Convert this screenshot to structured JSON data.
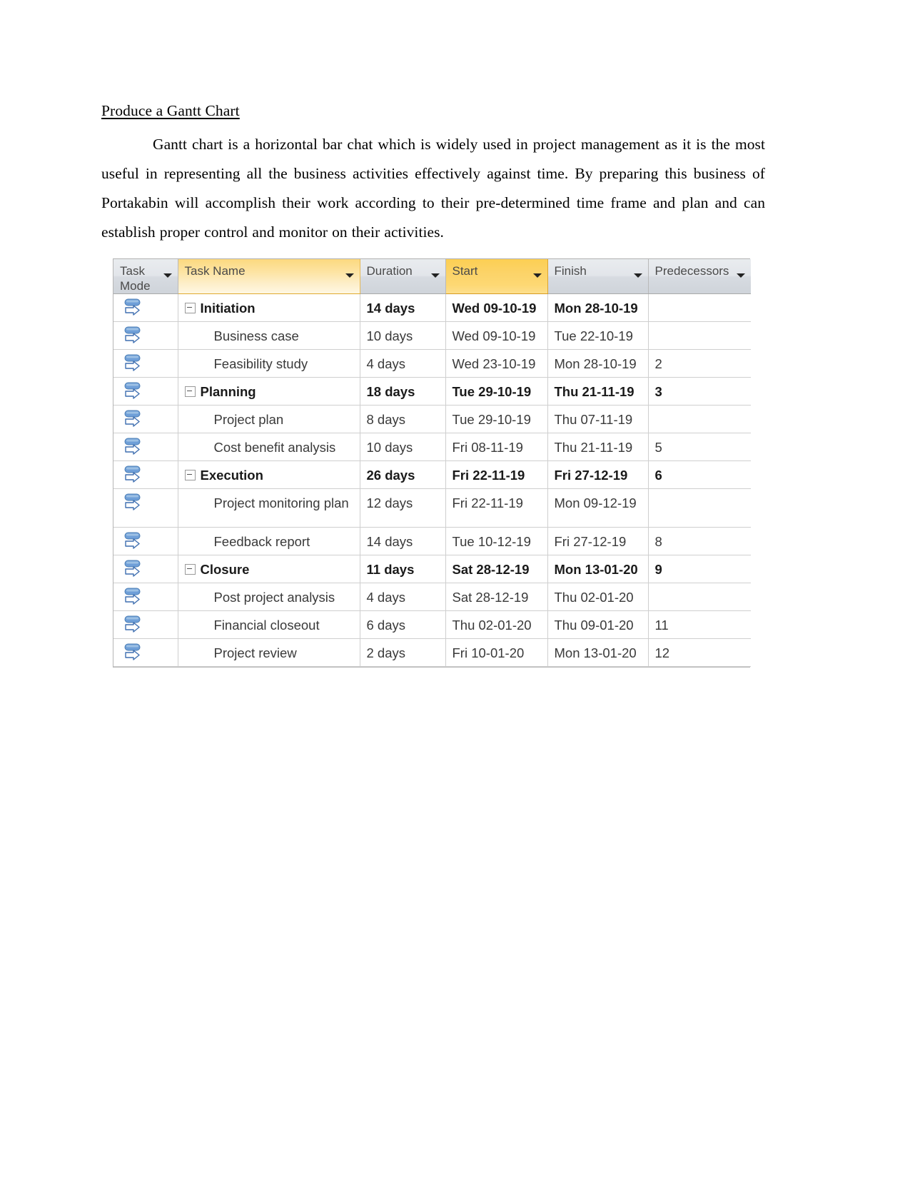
{
  "document": {
    "heading": "Produce a Gantt Chart",
    "paragraph": "Gantt chart is a horizontal bar chat which is widely used in project management as it is the most useful in representing all the business activities effectively against time. By preparing this business of Portakabin will accomplish their work according to their pre-determined time frame and plan and can establish proper control and monitor on their activities."
  },
  "colors": {
    "header_highlight_light": "#fde3a0",
    "header_highlight_strong": "#fcd368",
    "header_default": "#dfe3e8",
    "taskmode_icon_blue": "#6f9fd8",
    "grid_line": "#cfcfcf"
  },
  "grid": {
    "columns": [
      {
        "key": "mode",
        "label": "Task\nMode",
        "highlight": "none",
        "has_filter_arrow": true
      },
      {
        "key": "name",
        "label": "Task Name",
        "highlight": "light",
        "has_filter_arrow": true
      },
      {
        "key": "dur",
        "label": "Duration",
        "highlight": "none",
        "has_filter_arrow": true
      },
      {
        "key": "start",
        "label": "Start",
        "highlight": "strong",
        "has_filter_arrow": true
      },
      {
        "key": "fin",
        "label": "Finish",
        "highlight": "none",
        "has_filter_arrow": true
      },
      {
        "key": "pred",
        "label": "Predecessors",
        "highlight": "none",
        "has_filter_arrow": true
      }
    ],
    "task_mode_icon": "auto-scheduled-icon",
    "rows": [
      {
        "id": 1,
        "name": "Initiation",
        "level": 0,
        "summary": true,
        "duration": "14 days",
        "start": "Wed 09-10-19",
        "finish": "Mon 28-10-19",
        "predecessors": ""
      },
      {
        "id": 2,
        "name": "Business case",
        "level": 1,
        "summary": false,
        "duration": "10 days",
        "start": "Wed 09-10-19",
        "finish": "Tue 22-10-19",
        "predecessors": ""
      },
      {
        "id": 3,
        "name": "Feasibility study",
        "level": 1,
        "summary": false,
        "duration": "4 days",
        "start": "Wed 23-10-19",
        "finish": "Mon 28-10-19",
        "predecessors": "2"
      },
      {
        "id": 4,
        "name": "Planning",
        "level": 0,
        "summary": true,
        "duration": "18 days",
        "start": "Tue 29-10-19",
        "finish": "Thu 21-11-19",
        "predecessors": "3"
      },
      {
        "id": 5,
        "name": "Project plan",
        "level": 1,
        "summary": false,
        "duration": "8 days",
        "start": "Tue 29-10-19",
        "finish": "Thu 07-11-19",
        "predecessors": ""
      },
      {
        "id": 6,
        "name": "Cost benefit analysis",
        "level": 1,
        "summary": false,
        "duration": "10 days",
        "start": "Fri 08-11-19",
        "finish": "Thu 21-11-19",
        "predecessors": "5"
      },
      {
        "id": 7,
        "name": "Execution",
        "level": 0,
        "summary": true,
        "duration": "26 days",
        "start": "Fri 22-11-19",
        "finish": "Fri 27-12-19",
        "predecessors": "6"
      },
      {
        "id": 8,
        "name": "Project monitoring plan",
        "level": 1,
        "summary": false,
        "duration": "12 days",
        "start": "Fri 22-11-19",
        "finish": "Mon 09-12-19",
        "predecessors": ""
      },
      {
        "id": 9,
        "name": "Feedback report",
        "level": 1,
        "summary": false,
        "duration": "14 days",
        "start": "Tue 10-12-19",
        "finish": "Fri 27-12-19",
        "predecessors": "8"
      },
      {
        "id": 10,
        "name": "Closure",
        "level": 0,
        "summary": true,
        "duration": "11 days",
        "start": "Sat 28-12-19",
        "finish": "Mon 13-01-20",
        "predecessors": "9"
      },
      {
        "id": 11,
        "name": "Post project analysis",
        "level": 1,
        "summary": false,
        "duration": "4 days",
        "start": "Sat 28-12-19",
        "finish": "Thu 02-01-20",
        "predecessors": ""
      },
      {
        "id": 12,
        "name": "Financial closeout",
        "level": 1,
        "summary": false,
        "duration": "6 days",
        "start": "Thu 02-01-20",
        "finish": "Thu 09-01-20",
        "predecessors": "11"
      },
      {
        "id": 13,
        "name": "Project review",
        "level": 1,
        "summary": false,
        "duration": "2 days",
        "start": "Fri 10-01-20",
        "finish": "Mon 13-01-20",
        "predecessors": "12"
      }
    ]
  }
}
